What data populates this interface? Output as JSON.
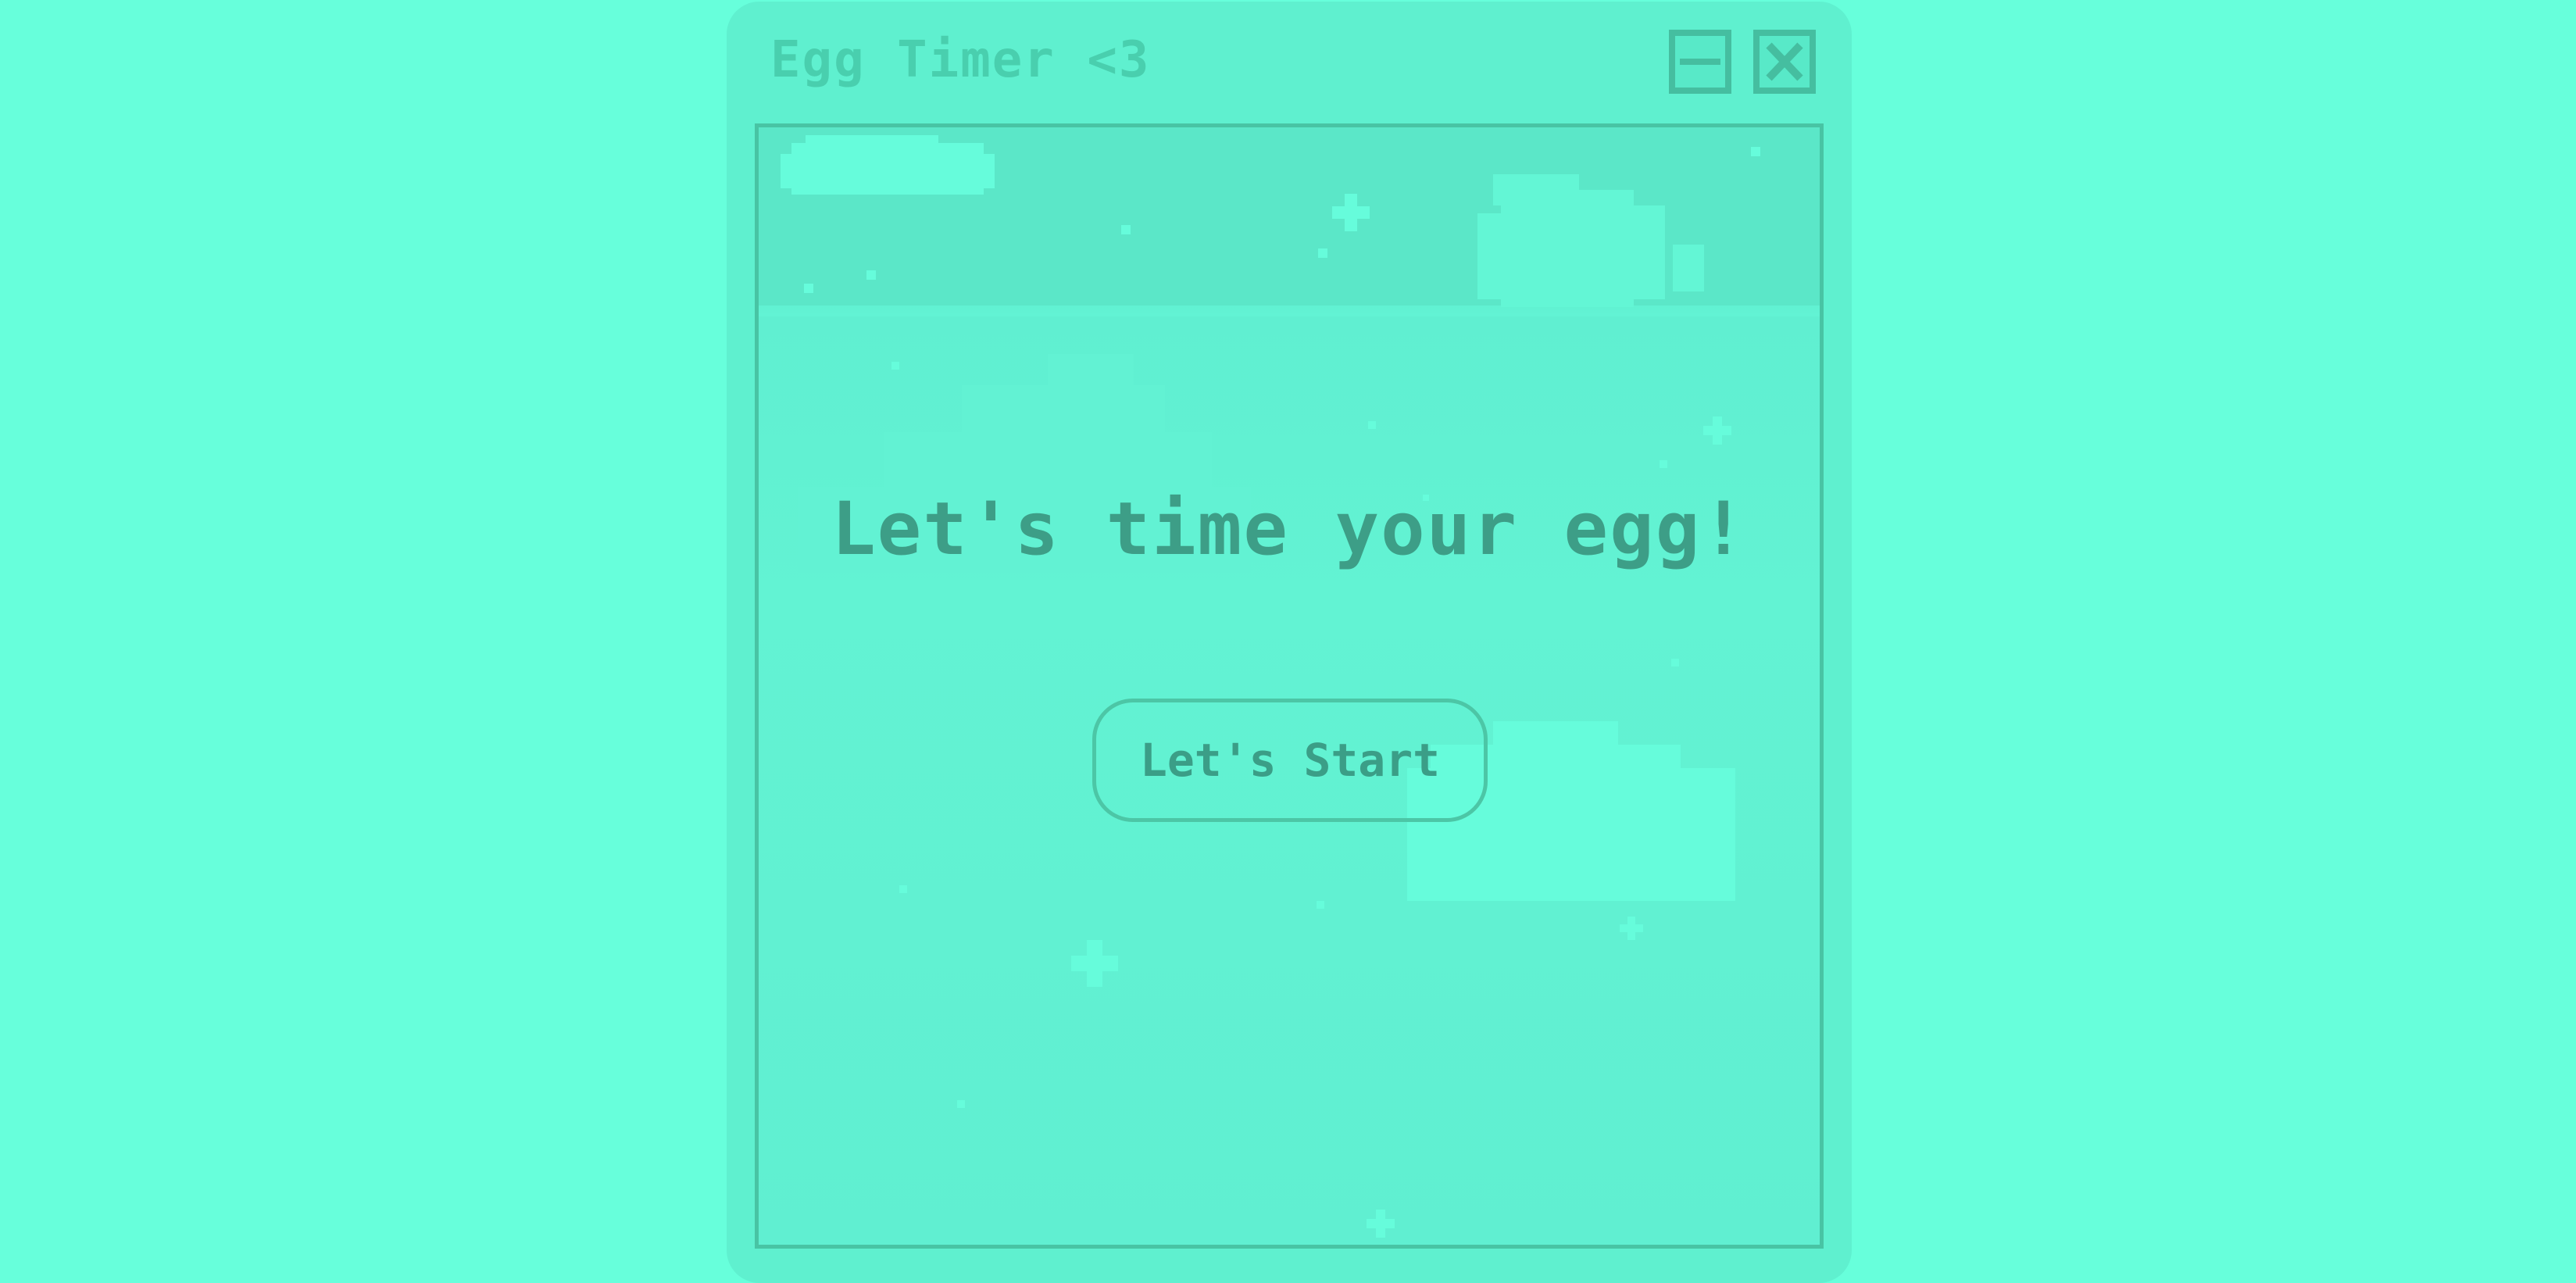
{
  "window": {
    "title": "Egg Timer <3",
    "minimize_icon": "minimize-icon",
    "close_icon": "close-icon"
  },
  "main": {
    "headline": "Let's time your egg!",
    "start_label": "Let's Start"
  },
  "colors": {
    "background": "#67ffdb",
    "window": "#5ff0cf",
    "text": "#3d9e87",
    "border": "#45bea0"
  }
}
